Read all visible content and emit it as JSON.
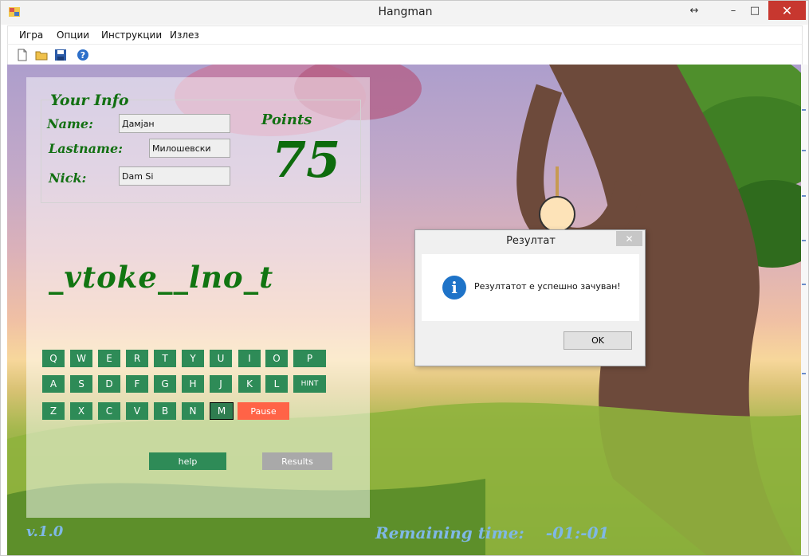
{
  "window": {
    "title": "Hangman",
    "controls": {
      "resize": "↔",
      "minimize": "–",
      "maximize": "□",
      "close": "✕"
    }
  },
  "menu": [
    "Игра",
    "Опции",
    "Инструкции",
    "Излез"
  ],
  "toolbar": {
    "icons": [
      "new-file-icon",
      "open-folder-icon",
      "save-icon",
      "help-icon"
    ]
  },
  "info": {
    "section_title": "Your Info",
    "name_label": "Name:",
    "name_value": "Дамјан",
    "lastname_label": "Lastname:",
    "lastname_value": "Милошевски",
    "nick_label": "Nick:",
    "nick_value": "Dam Si"
  },
  "points": {
    "label": "Points",
    "value": "75"
  },
  "word": "_vtoke__lno_t",
  "keyboard": {
    "row1": [
      "Q",
      "W",
      "E",
      "R",
      "T",
      "Y",
      "U",
      "I",
      "O",
      "P"
    ],
    "row2": [
      "A",
      "S",
      "D",
      "F",
      "G",
      "H",
      "J",
      "K",
      "L"
    ],
    "row3": [
      "Z",
      "X",
      "C",
      "V",
      "B",
      "N",
      "M"
    ],
    "hint_label": "HINT",
    "pause_label": "Pause"
  },
  "buttons": {
    "help": "help",
    "results": "Results"
  },
  "footer": {
    "version": "v.1.0",
    "remaining_label": "Remaining time:",
    "remaining_value": "-01:-01"
  },
  "dialog": {
    "title": "Резултат",
    "message": "Резултатот е успешно зачуван!",
    "ok": "OK",
    "close": "✕"
  },
  "colors": {
    "key_green": "#2e8b57",
    "pause_red": "#ff6347",
    "title_green": "#127012",
    "results_gray": "#a9a9a9"
  }
}
